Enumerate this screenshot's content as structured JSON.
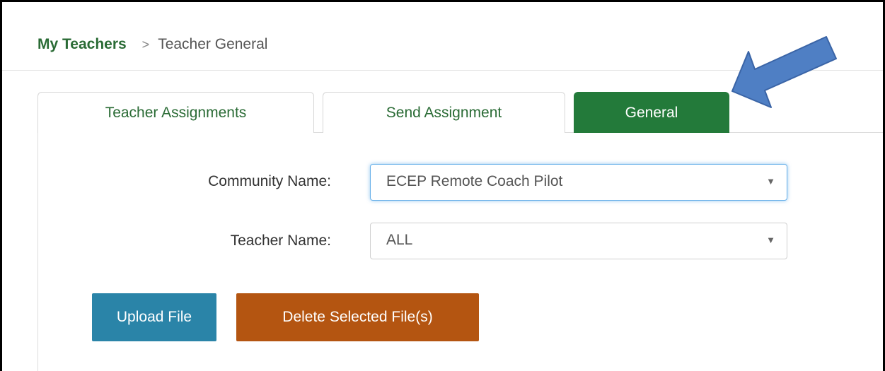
{
  "breadcrumb": {
    "parent": "My Teachers",
    "separator": ">",
    "current": "Teacher General"
  },
  "tabs": [
    {
      "label": "Teacher Assignments",
      "active": false
    },
    {
      "label": "Send Assignment",
      "active": false
    },
    {
      "label": "General",
      "active": true
    }
  ],
  "form": {
    "community_label": "Community Name:",
    "community_value": "ECEP Remote Coach Pilot",
    "teacher_label": "Teacher Name:",
    "teacher_value": "ALL",
    "caret_glyph": "▼"
  },
  "buttons": {
    "upload_label": "Upload File",
    "delete_label": "Delete Selected File(s)"
  },
  "colors": {
    "brand_green": "#237a3a",
    "upload_blue": "#2a84a8",
    "delete_orange": "#b45511",
    "annotation_arrow": "#4f7fc4"
  },
  "annotation": {
    "icon": "arrow-pointer-icon"
  }
}
